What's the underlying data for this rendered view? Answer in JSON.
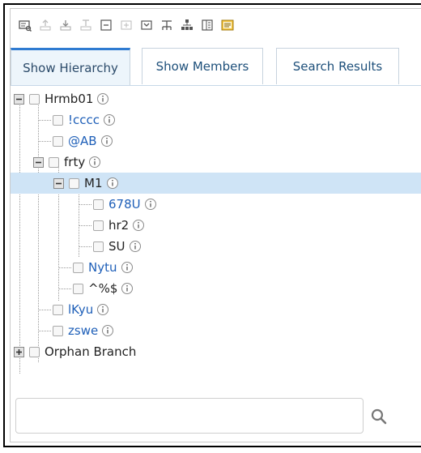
{
  "toolbar": {
    "buttons": [
      {
        "icon": "find-icon",
        "enabled": true
      },
      {
        "icon": "move-up-icon",
        "enabled": false
      },
      {
        "icon": "move-down-icon",
        "enabled": false
      },
      {
        "icon": "level-icon",
        "enabled": false
      },
      {
        "icon": "collapse-all-icon",
        "enabled": true
      },
      {
        "icon": "expand-icon",
        "enabled": false
      },
      {
        "icon": "expand-all-icon",
        "enabled": true
      },
      {
        "icon": "hierarchy-icon",
        "enabled": true
      },
      {
        "icon": "org-chart-icon",
        "enabled": true
      },
      {
        "icon": "details-icon",
        "enabled": true
      },
      {
        "icon": "report-icon",
        "enabled": true
      }
    ]
  },
  "tabs": [
    {
      "label": "Show Hierarchy",
      "active": true
    },
    {
      "label": "Show Members",
      "active": false
    },
    {
      "label": "Search Results",
      "active": false
    }
  ],
  "tree": [
    {
      "label": "Hrmb01",
      "depth": 0,
      "expander": "minus",
      "style": "black"
    },
    {
      "label": "!cccc",
      "depth": 1,
      "expander": null,
      "style": "blue"
    },
    {
      "label": "@AB",
      "depth": 1,
      "expander": null,
      "style": "blue"
    },
    {
      "label": "frty",
      "depth": 1,
      "expander": "minus",
      "style": "black"
    },
    {
      "label": "M1",
      "depth": 2,
      "expander": "minus",
      "style": "black",
      "selected": true
    },
    {
      "label": "678U",
      "depth": 3,
      "expander": null,
      "style": "blue"
    },
    {
      "label": "hr2",
      "depth": 3,
      "expander": null,
      "style": "black"
    },
    {
      "label": "SU",
      "depth": 3,
      "expander": null,
      "style": "black"
    },
    {
      "label": "Nytu",
      "depth": 2,
      "expander": null,
      "style": "blue"
    },
    {
      "label": "^%$",
      "depth": 2,
      "expander": null,
      "style": "black"
    },
    {
      "label": "lKyu",
      "depth": 1,
      "expander": null,
      "style": "blue"
    },
    {
      "label": "zswe",
      "depth": 1,
      "expander": null,
      "style": "blue"
    },
    {
      "label": "Orphan Branch",
      "depth": 0,
      "expander": "plus",
      "style": "black"
    }
  ],
  "search": {
    "value": "",
    "placeholder": "",
    "button_icon": "search-icon"
  },
  "colors": {
    "accent": "#2f7bd1",
    "selected_row": "#cfe4f6",
    "link_blue": "#1e5fb8",
    "tab_text": "#1d4f7a"
  }
}
